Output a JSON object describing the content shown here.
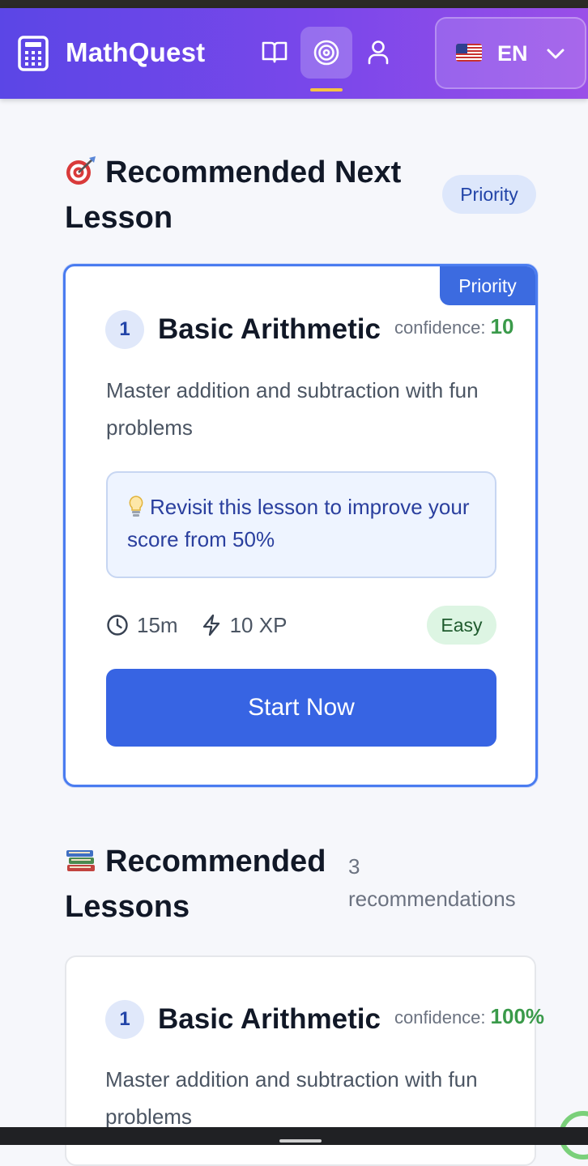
{
  "header": {
    "brand": "MathQuest",
    "nav": [
      {
        "icon": "book-icon",
        "active": false
      },
      {
        "icon": "target-icon",
        "active": true
      },
      {
        "icon": "user-icon",
        "active": false
      }
    ],
    "language": {
      "flag": "us-flag-icon",
      "code": "EN"
    }
  },
  "next_section": {
    "emoji": "dart-emoji-icon",
    "title": "Recommended Next Lesson",
    "badge": "Priority"
  },
  "next_card": {
    "ribbon": "Priority",
    "number": "1",
    "title": "Basic Arithmetic",
    "confidence_label": "confidence:",
    "confidence_value": "10",
    "description": "Master addition and subtraction with fun problems",
    "hint_emoji": "lightbulb-icon",
    "hint": "Revisit this lesson to improve your score from 50%",
    "duration": "15m",
    "xp": "10 XP",
    "difficulty": "Easy",
    "cta": "Start Now"
  },
  "rec_section": {
    "emoji": "books-emoji-icon",
    "title": "Recommended Lessons",
    "count_number": "3",
    "count_label": "recommendations"
  },
  "rec_card": {
    "number": "1",
    "title": "Basic Arithmetic",
    "confidence_label": "confidence:",
    "confidence_value": "100%",
    "description": "Master addition and subtraction with fun problems"
  },
  "colors": {
    "header_start": "#5b46e6",
    "header_end": "#9a4fe8",
    "primary": "#3764e3",
    "confidence_green": "#3a9a4a",
    "active_underline": "#f6c343"
  }
}
